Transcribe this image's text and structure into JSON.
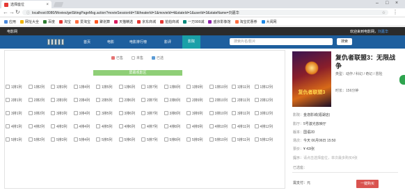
{
  "browser": {
    "tab_title": "选择座位",
    "url": "localhost:8080/Movies/getSitingPageMsg.action?movieSessionId=7&theaterId=1&movieId=4&stateId=1&userId=3&stateName=刘嘉华",
    "bookmarks": [
      "应用",
      "网址大全",
      "百度",
      "淘宝",
      "爱淘宝",
      "聚划算",
      "天猫精选",
      "京东商城",
      "拍拍商城",
      "一万999减",
      "盛京影像馆",
      "淘宝优惠券",
      "大阅网"
    ]
  },
  "topbar": {
    "brand": "电影网",
    "welcome": "欢迎来到电影网，",
    "username": "刘嘉华"
  },
  "nav": {
    "links": [
      "首页",
      "电影",
      "电影排行榜",
      "影评",
      "影院"
    ],
    "active_index": 4,
    "search_placeholder": "搜索片名/影片",
    "search_button": "搜索"
  },
  "legend": [
    "已售",
    "未售",
    "已选"
  ],
  "screen_label": "屏幕观影区",
  "seat_rows": [
    [
      "1排1列",
      "1排2列",
      "1排3列",
      "1排4列",
      "1排5列",
      "1排6列",
      "1排7列",
      "1排8列",
      "1排9列",
      "1排10列",
      "1排11列",
      "1排12列"
    ],
    [
      "2排1列",
      "2排2列",
      "2排3列",
      "2排4列",
      "2排5列",
      "2排6列",
      "2排7列",
      "2排8列",
      "2排9列",
      "2排10列",
      "2排11列",
      "2排12列"
    ],
    [
      "3排1列",
      "3排2列",
      "3排3列",
      "3排4列",
      "3排5列",
      "3排6列",
      "3排7列",
      "3排8列",
      "3排9列",
      "3排10列",
      "3排11列",
      "3排12列"
    ],
    [
      "4排1列",
      "4排2列",
      "4排3列",
      "4排4列",
      "4排5列",
      "4排6列",
      "4排7列",
      "4排8列",
      "4排9列",
      "4排10列",
      "4排11列",
      "4排12列"
    ],
    [
      "5排1列",
      "5排2列",
      "5排3列",
      "5排4列",
      "5排5列",
      "5排6列",
      "5排7列",
      "5排8列",
      "5排9列",
      "5排10列",
      "5排11列",
      "5排12列"
    ]
  ],
  "movie": {
    "title": "复仇者联盟3：无限战争",
    "poster_text": "复仇者联盟3",
    "genre_label": "类型：",
    "genre": "动作 / 科幻 / 奇幻 / 冒险",
    "duration_label": "时长：",
    "duration": "156分钟"
  },
  "details": [
    {
      "k": "影院：",
      "v": "金逸影城(福湖店)"
    },
    {
      "k": "影厅：",
      "v": "5号激光放映厅"
    },
    {
      "k": "版本：",
      "v": "国语2D"
    },
    {
      "k": "场次：",
      "v": "今天 06月06日 15:50"
    },
    {
      "k": "票价：",
      "v": "¥ 43/张"
    },
    {
      "k": "提示：",
      "v": "请点击选择座位，单次最多购买4张"
    },
    {
      "k": "已选座：",
      "v": ""
    }
  ],
  "total_label": "需支付：元",
  "buy_button": "一键购买",
  "colors": {
    "nav": "#1e5f9e",
    "active": "#1aa0a8",
    "screen": "#8fcf77",
    "buy": "#d9534f"
  }
}
